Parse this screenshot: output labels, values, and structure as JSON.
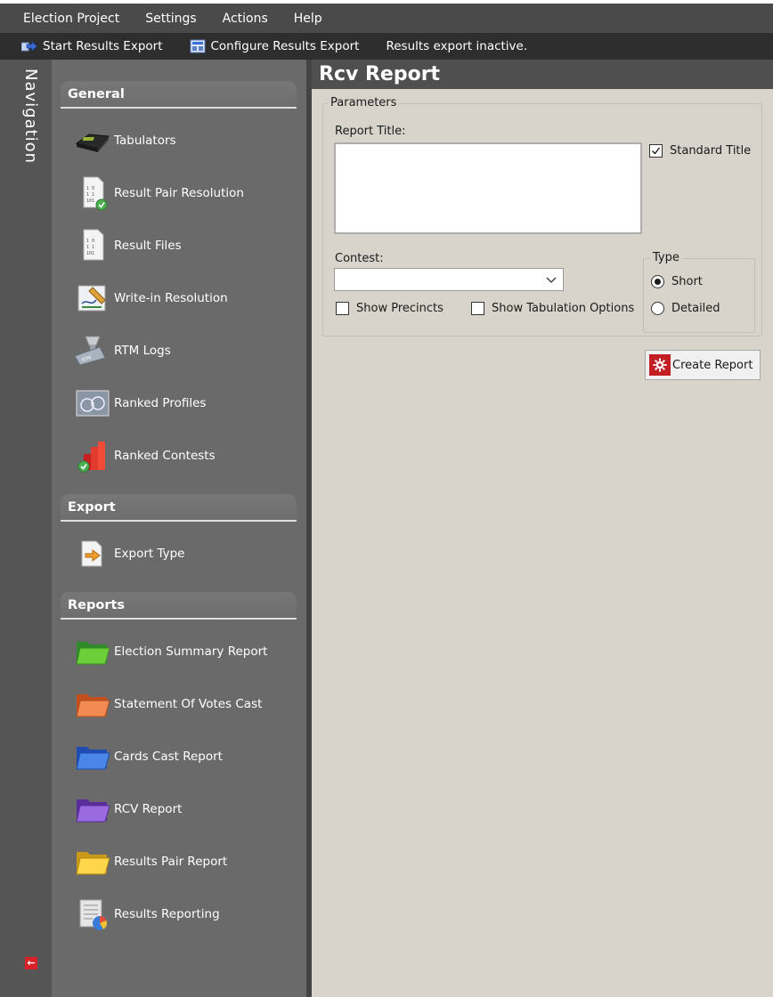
{
  "menu": {
    "items": [
      "Election Project",
      "Settings",
      "Actions",
      "Help"
    ]
  },
  "toolbar": {
    "start_label": "Start Results Export",
    "configure_label": "Configure Results Export",
    "status": "Results export inactive."
  },
  "navtab": {
    "label": "Navigation"
  },
  "nav": {
    "sections": [
      {
        "title": "General",
        "items": [
          {
            "label": "Tabulators",
            "icon": "tabulator-icon"
          },
          {
            "label": "Result Pair Resolution",
            "icon": "result-pair-resolution-icon"
          },
          {
            "label": "Result Files",
            "icon": "result-files-icon"
          },
          {
            "label": "Write-in Resolution",
            "icon": "write-in-resolution-icon"
          },
          {
            "label": "RTM Logs",
            "icon": "rtm-logs-icon"
          },
          {
            "label": "Ranked Profiles",
            "icon": "ranked-profiles-icon"
          },
          {
            "label": "Ranked Contests",
            "icon": "ranked-contests-icon"
          }
        ]
      },
      {
        "title": "Export",
        "items": [
          {
            "label": "Export Type",
            "icon": "export-type-icon"
          }
        ]
      },
      {
        "title": "Reports",
        "items": [
          {
            "label": "Election Summary Report",
            "icon": "green-folder-icon"
          },
          {
            "label": "Statement Of Votes Cast",
            "icon": "orange-folder-icon"
          },
          {
            "label": "Cards Cast Report",
            "icon": "blue-folder-icon"
          },
          {
            "label": "RCV Report",
            "icon": "purple-folder-icon"
          },
          {
            "label": "Results Pair Report",
            "icon": "yellow-folder-icon"
          },
          {
            "label": "Results Reporting",
            "icon": "results-reporting-icon"
          }
        ]
      }
    ]
  },
  "main": {
    "title": "Rcv Report",
    "parameters_label": "Parameters",
    "report_title_label": "Report Title:",
    "report_title_value": "",
    "standard_title_label": "Standard Title",
    "standard_title_checked": true,
    "contest_label": "Contest:",
    "contest_value": "",
    "show_precincts_label": "Show Precincts",
    "show_precincts_checked": false,
    "show_tabulation_label": "Show Tabulation Options",
    "show_tabulation_checked": false,
    "type_label": "Type",
    "type_short_label": "Short",
    "type_detailed_label": "Detailed",
    "type_selected": "Short",
    "create_report_label": "Create Report"
  },
  "colors": {
    "menubar": "#4a4a4a",
    "toolbar": "#2e2e2e",
    "nav_panel": "#6a6a6a",
    "main_bg": "#d8d4cc",
    "accent_red": "#c41e25"
  }
}
